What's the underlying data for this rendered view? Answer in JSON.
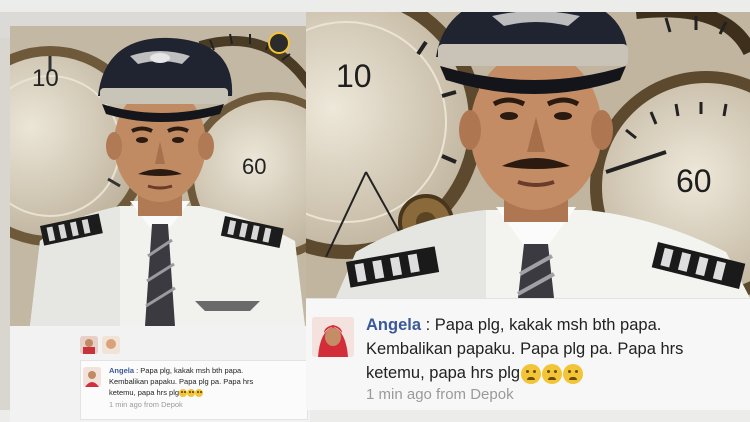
{
  "comment": {
    "author": "Angela",
    "separator": " : ",
    "line1": "Papa plg, kakak msh bth papa.",
    "line2": "Kembalikan papaku. Papa plg pa. Papa hrs",
    "line3": "ketemu, papa hrs plg",
    "emoji_count": 3,
    "meta": "1 min ago from Depok"
  },
  "small_comment": {
    "author": "Angela",
    "separator": " : ",
    "line1": "Papa plg, kakak msh bth papa.",
    "line2": "Kembalikan papaku. Papa plg pa. Papa hrs",
    "line3": "ketemu, papa hrs plg",
    "meta": "1 min ago from Depok"
  },
  "colors": {
    "author_link": "#3b5998",
    "meta_gray": "#9a9a9a",
    "uniform_white": "#f4f4f2",
    "cap_navy": "#1f2430",
    "epaulette_gold": "#c9a44a"
  },
  "icons": [
    "pilot-photo",
    "clock-background",
    "avatar",
    "crying-emoji"
  ]
}
